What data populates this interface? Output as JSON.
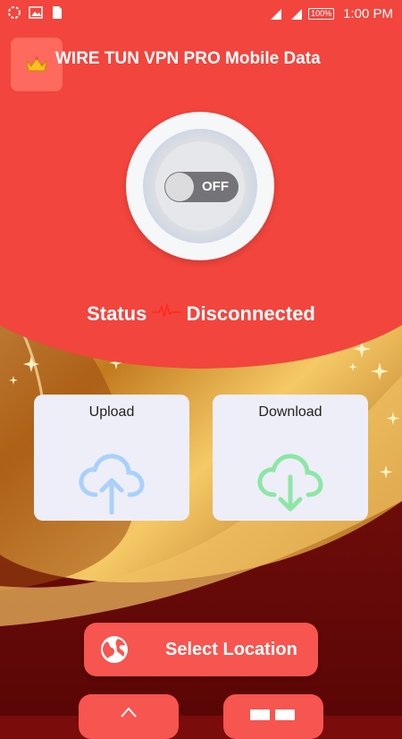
{
  "statusbar": {
    "time": "1:00 PM",
    "battery": "100%",
    "network": "4G"
  },
  "app": {
    "title": "WIRE TUN VPN PRO Mobile Data",
    "icon": "crown-icon"
  },
  "power": {
    "toggle_label": "OFF",
    "state": "off"
  },
  "status": {
    "label": "Status",
    "value": "Disconnected"
  },
  "cards": {
    "upload": {
      "title": "Upload",
      "icon": "cloud-upload-icon",
      "color": "#a9d1fb"
    },
    "download": {
      "title": "Download",
      "icon": "cloud-download-icon",
      "color": "#8de6a6"
    }
  },
  "location": {
    "label": "Select Location",
    "icon": "globe-icon"
  },
  "colors": {
    "accent": "#f7554f",
    "header": "#f2453d",
    "gold": "#e0a13a"
  }
}
